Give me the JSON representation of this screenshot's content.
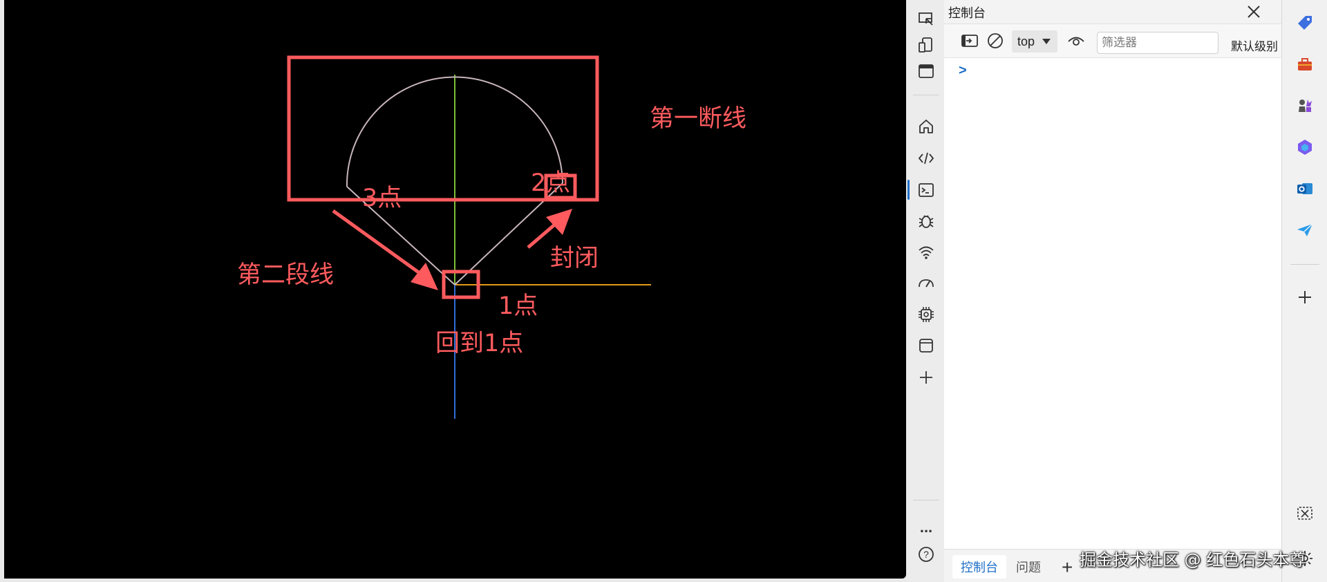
{
  "canvas": {
    "annotations": {
      "first_line": "第一断线",
      "second_line": "第二段线",
      "point3": "3点",
      "point2": "2点",
      "point1": "1点",
      "close": "封闭",
      "back_to_point1": "回到1点"
    },
    "colors": {
      "annotation": "#ff5b5e",
      "shape_stroke": "#c9b6bd",
      "axis_y": "#7ec03a",
      "axis_x": "#e59b16",
      "axis_z": "#2f6fd6"
    }
  },
  "devtools": {
    "activity_bar": {
      "icons": [
        "inspect-icon",
        "device-emulation-icon",
        "dock-icon",
        "home-icon",
        "elements-icon",
        "console-icon",
        "sources-icon",
        "network-icon",
        "performance-icon",
        "memory-icon",
        "application-icon",
        "add-tool-icon",
        "more-tools-icon",
        "help-icon"
      ],
      "more_label": "...",
      "help_label": "?"
    },
    "panel": {
      "title": "控制台",
      "toolbar": {
        "context": "top",
        "filter_placeholder": "筛选器",
        "level_label": "默认级别"
      },
      "prompt": ">",
      "bottom_tabs": [
        {
          "label": "控制台",
          "active": true
        },
        {
          "label": "问题",
          "active": false
        }
      ],
      "add_tab_label": "+"
    }
  },
  "browser_sidebar": {
    "icons": [
      "tag-icon",
      "toolbox-icon",
      "chess-icon",
      "copilot-icon",
      "outlook-icon",
      "send-icon",
      "add-icon",
      "screenshot-icon",
      "settings-icon"
    ]
  },
  "watermark": "掘金技术社区 @ 红色石头本尊"
}
